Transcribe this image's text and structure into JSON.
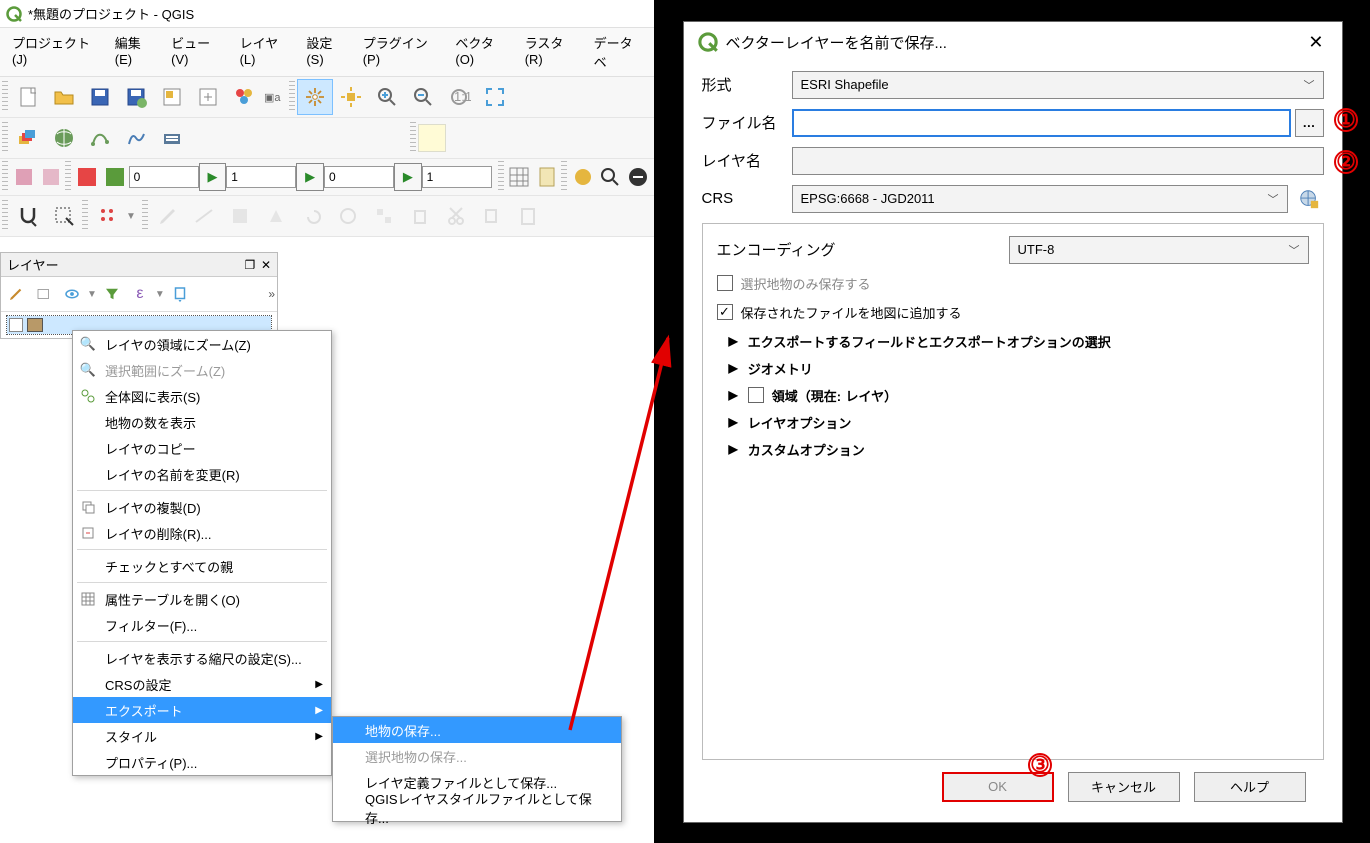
{
  "window": {
    "title": "*無題のプロジェクト - QGIS"
  },
  "menu": {
    "project": "プロジェクト(J)",
    "edit": "編集(E)",
    "view": "ビュー(V)",
    "layer": "レイヤ(L)",
    "settings": "設定(S)",
    "plugin": "プラグイン(P)",
    "vector": "ベクタ(O)",
    "raster": "ラスタ(R)",
    "database": "データベ"
  },
  "toolbar3": {
    "val0": "0",
    "val1": "1",
    "val2": "0",
    "val3": "1"
  },
  "layers": {
    "title": "レイヤー",
    "item1": ""
  },
  "ctx": {
    "zoom_layer": "レイヤの領域にズーム(Z)",
    "zoom_sel": "選択範囲にズーム(Z)",
    "show_all": "全体図に表示(S)",
    "feature_count": "地物の数を表示",
    "copy": "レイヤのコピー",
    "rename": "レイヤの名前を変更(R)",
    "duplicate": "レイヤの複製(D)",
    "delete": "レイヤの削除(R)...",
    "check_parents": "チェックとすべての親",
    "attr_table": "属性テーブルを開く(O)",
    "filter": "フィルター(F)...",
    "scale_vis": "レイヤを表示する縮尺の設定(S)...",
    "crs_setting": "CRSの設定",
    "export": "エクスポート",
    "style": "スタイル",
    "properties": "プロパティ(P)..."
  },
  "submenu": {
    "save_features": "地物の保存...",
    "save_selected": "選択地物の保存...",
    "save_layerdef": "レイヤ定義ファイルとして保存...",
    "save_style": "QGISレイヤスタイルファイルとして保存..."
  },
  "dialog": {
    "title": "ベクターレイヤーを名前で保存...",
    "format_label": "形式",
    "format_value": "ESRI Shapefile",
    "filename_label": "ファイル名",
    "filename_value": "",
    "layername_label": "レイヤ名",
    "layername_value": "",
    "crs_label": "CRS",
    "crs_value": "EPSG:6668 - JGD2011",
    "encoding_label": "エンコーディング",
    "encoding_value": "UTF-8",
    "chk_selected_only": "選択地物のみ保存する",
    "chk_add_to_map": "保存されたファイルを地図に追加する",
    "grp_fields": "エクスポートするフィールドとエクスポートオプションの選択",
    "grp_geom": "ジオメトリ",
    "grp_extent_prefix": "領域（現在:",
    "grp_extent_suffix": "レイヤ）",
    "grp_layer_opts": "レイヤオプション",
    "grp_custom_opts": "カスタムオプション",
    "btn_ok": "OK",
    "btn_cancel": "キャンセル",
    "btn_help": "ヘルプ"
  },
  "annotations": {
    "n1": "①",
    "n2": "②",
    "n3": "③"
  }
}
